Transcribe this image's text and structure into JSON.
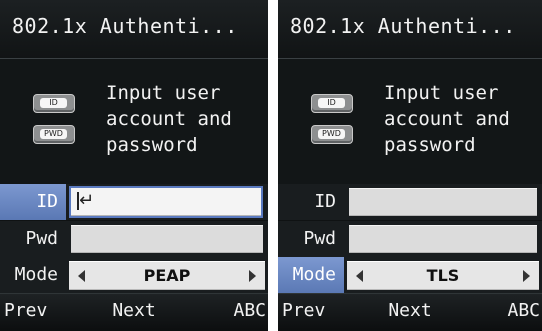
{
  "screens": [
    {
      "title": "802.1x Authenti...",
      "instruction_lines": [
        "Input user",
        "account and",
        "password"
      ],
      "badges": {
        "id": "ID",
        "pwd": "PWD"
      },
      "fields": {
        "id_label": "ID",
        "pwd_label": "Pwd",
        "mode_label": "Mode"
      },
      "mode_value": "PEAP",
      "selected_row": "id",
      "softkeys": {
        "left": "Prev",
        "center": "Next",
        "right": "ABC"
      }
    },
    {
      "title": "802.1x Authenti...",
      "instruction_lines": [
        "Input user",
        "account and",
        "password"
      ],
      "badges": {
        "id": "ID",
        "pwd": "PWD"
      },
      "fields": {
        "id_label": "ID",
        "pwd_label": "Pwd",
        "mode_label": "Mode"
      },
      "mode_value": "TLS",
      "selected_row": "mode",
      "softkeys": {
        "left": "Prev",
        "center": "Next",
        "right": "ABC"
      }
    }
  ],
  "icons": {
    "enter": "enter-return-icon",
    "left_arrow": "triangle-left-icon",
    "right_arrow": "triangle-right-icon"
  },
  "colors": {
    "selected_label": "#6d89c4",
    "active_field_border": "#5a7ac0",
    "screen_background": "#0f1213"
  }
}
